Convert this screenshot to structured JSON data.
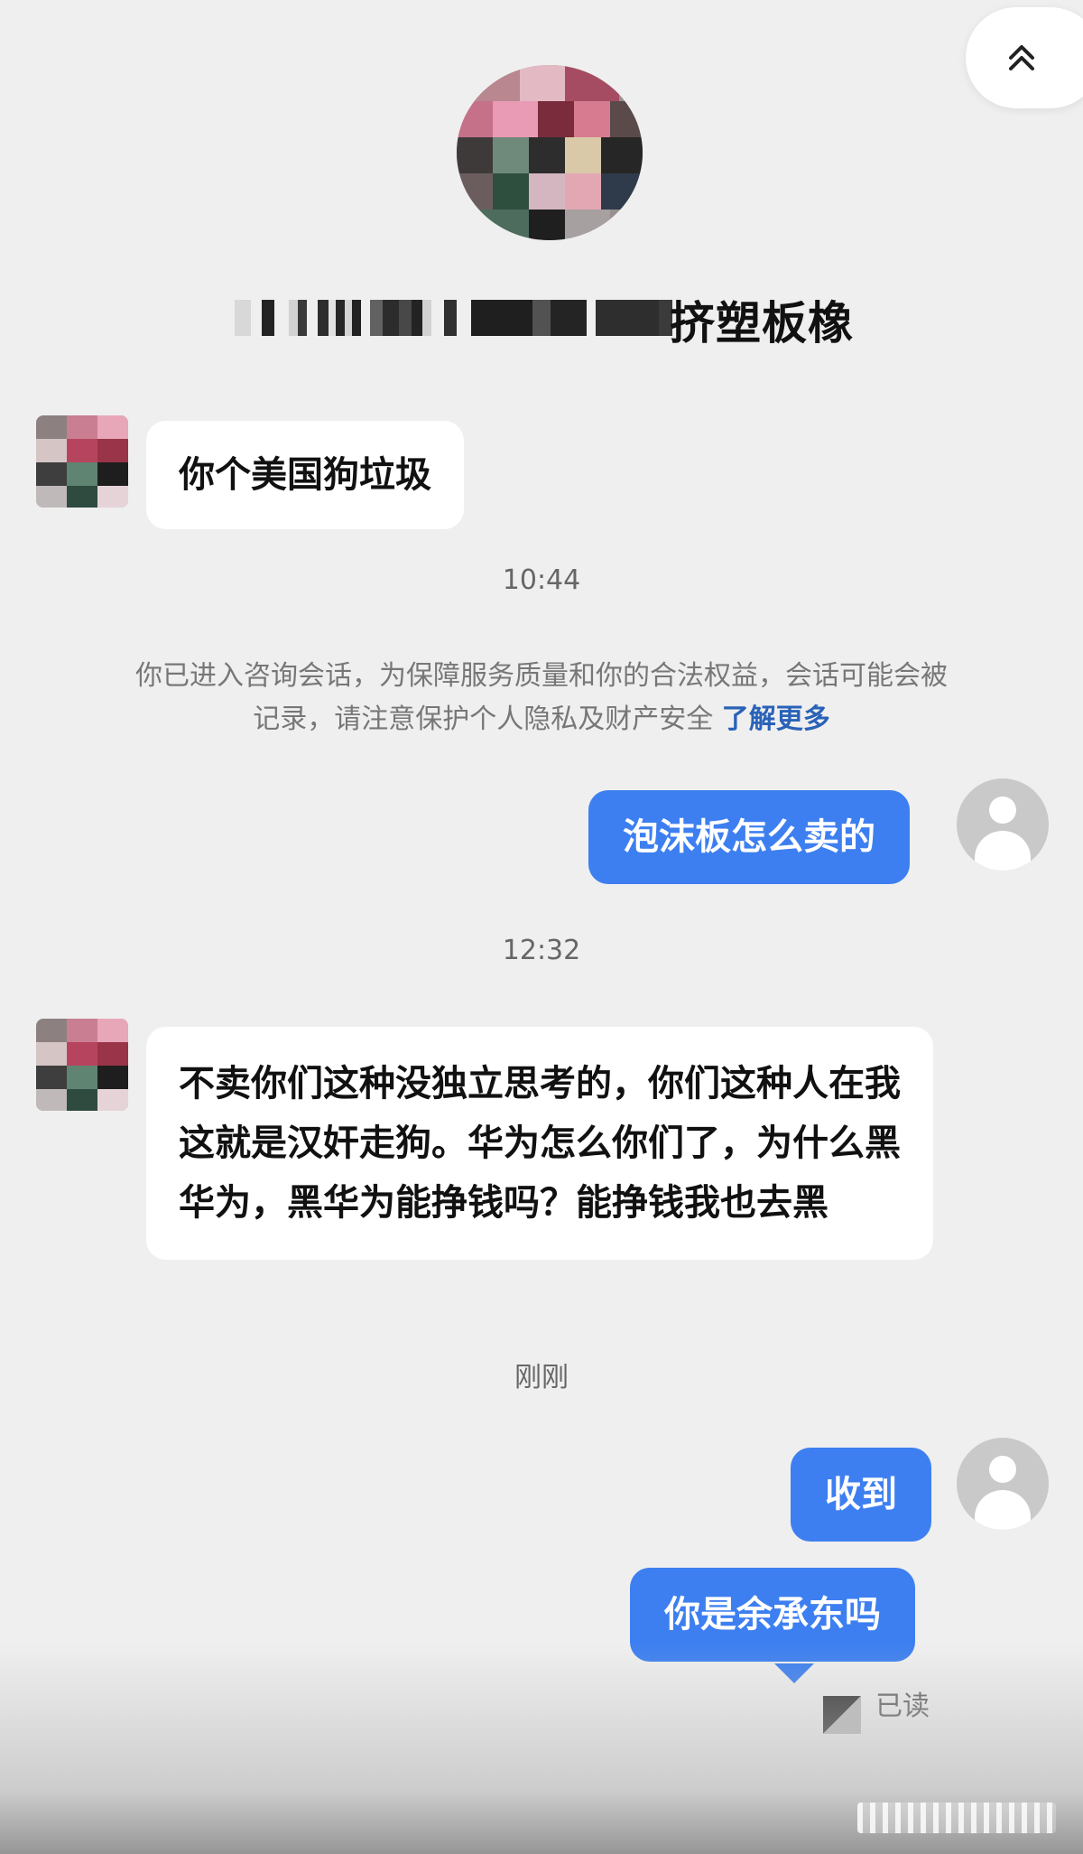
{
  "shop": {
    "name_visible": "挤塑板橡"
  },
  "messages": {
    "m1": "你个美国狗垃圾",
    "ts1": "10:44",
    "notice_text": "你已进入咨询会话，为保障服务质量和你的合法权益，会话可能会被记录，请注意保护个人隐私及财产安全",
    "notice_link": "了解更多",
    "m2": "泡沫板怎么卖的",
    "ts2": "12:32",
    "m3": "不卖你们这种没独立思考的，你们这种人在我这就是汉奸走狗。华为怎么你们了，为什么黑华为，黑华为能挣钱吗？能挣钱我也去黑",
    "ts3": "刚刚",
    "m4": "收到",
    "m5": "你是余承东吗",
    "read_status": "已读"
  },
  "colors": {
    "background": "#efefef",
    "outgoing_bubble": "#3d7ff0",
    "incoming_bubble": "#ffffff",
    "link": "#2a62b8"
  },
  "icons": {
    "collapse": "chevron-double-up-icon",
    "user_avatar": "default-user-icon"
  }
}
